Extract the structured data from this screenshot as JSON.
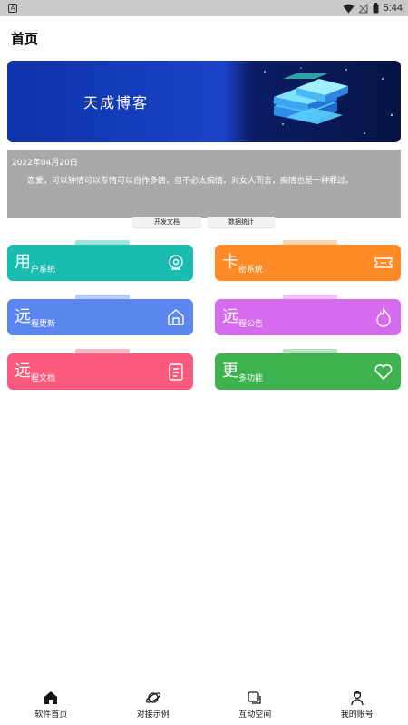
{
  "status_bar": {
    "time": "5:44",
    "app_icon_letter": "A"
  },
  "page": {
    "title": "首页"
  },
  "banner": {
    "text": "天成博客"
  },
  "notice": {
    "date": "2022年04月20日",
    "text": "恋爱，可以钟情可以专情可以自作多情，但不必太痴情。对女人而言，痴情也是一种罪过。"
  },
  "tabs": [
    {
      "label": "开发文档"
    },
    {
      "label": "数据统计"
    }
  ],
  "cards": [
    {
      "big": "用",
      "small": "户系统",
      "color": "#1bbcb0",
      "tab_color": "#9fe3dd",
      "icon": "headset-icon"
    },
    {
      "big": "卡",
      "small": "密系统",
      "color": "#ff8a26",
      "tab_color": "#ffd3ad",
      "icon": "ticket-icon"
    },
    {
      "big": "远",
      "small": "程更新",
      "color": "#5b86f0",
      "tab_color": "#b9cdf9",
      "icon": "home-icon"
    },
    {
      "big": "远",
      "small": "程公告",
      "color": "#d66bf0",
      "tab_color": "#f0c3f9",
      "icon": "flame-icon"
    },
    {
      "big": "远",
      "small": "程文档",
      "color": "#fb5a7c",
      "tab_color": "#fbb6c5",
      "icon": "document-icon"
    },
    {
      "big": "更",
      "small": "多功能",
      "color": "#3db24e",
      "tab_color": "#b4e2bb",
      "icon": "heart-icon"
    }
  ],
  "bottom_nav": [
    {
      "label": "软件首页",
      "icon": "home-filled-icon"
    },
    {
      "label": "对接示例",
      "icon": "planet-icon"
    },
    {
      "label": "互动空间",
      "icon": "chat-icon"
    },
    {
      "label": "我的账号",
      "icon": "user-icon"
    }
  ]
}
